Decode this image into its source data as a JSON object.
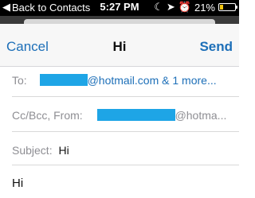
{
  "status_bar": {
    "back_label": "Back to Contacts",
    "time": "5:27 PM",
    "battery_percent": "21%",
    "battery_level": 0.21
  },
  "nav": {
    "cancel_label": "Cancel",
    "title": "Hi",
    "send_label": "Send"
  },
  "compose": {
    "to_label": "To:",
    "to_value": "@hotmail.com & 1 more...",
    "cc_label": "Cc/Bcc, From:",
    "from_value": "@hotma...",
    "subject_label": "Subject:",
    "subject_value": "Hi",
    "body": "Hi"
  },
  "colors": {
    "accent": "#1d6fb8",
    "redaction": "#1ea5e6"
  }
}
